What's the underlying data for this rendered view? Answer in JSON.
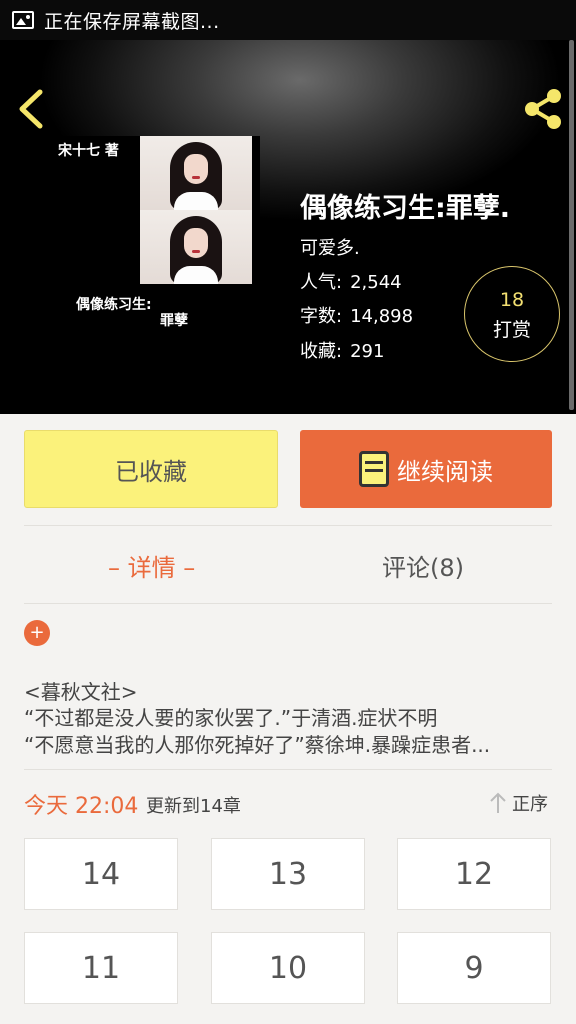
{
  "status_bar": {
    "text": "正在保存屏幕截图...",
    "icon": "image-icon"
  },
  "book": {
    "cover_author": "宋十七 著",
    "cover_title_line1": "偶像练习生:",
    "cover_title_line2": "罪孽",
    "title": "偶像练习生:罪孽.",
    "author": "可爱多.",
    "stats": [
      {
        "label": "人气:",
        "value": "2,544"
      },
      {
        "label": "字数:",
        "value": "14,898"
      },
      {
        "label": "收藏:",
        "value": "291"
      }
    ],
    "tip": {
      "count": "18",
      "label": "打赏"
    }
  },
  "actions": {
    "favorite_label": "已收藏",
    "read_label": "继续阅读"
  },
  "tabs": {
    "detail": "– 详情 –",
    "comments": "评论(8)"
  },
  "description": {
    "expand_label": "+",
    "lines": [
      "<暮秋文社>",
      "“不过都是没人要的家伙罢了.”于清酒.症状不明",
      "“不愿意当我的人那你死掉好了”蔡徐坤.暴躁症患者..."
    ]
  },
  "update": {
    "time": "今天 22:04",
    "text": "更新到14章",
    "sort_label": "正序"
  },
  "chapters": [
    "14",
    "13",
    "12",
    "11",
    "10",
    "9"
  ],
  "colors": {
    "accent": "#ea6a3c",
    "favorite_bg": "#fbf27b",
    "tip_number": "#f3e072",
    "header_bg": "#000000"
  }
}
